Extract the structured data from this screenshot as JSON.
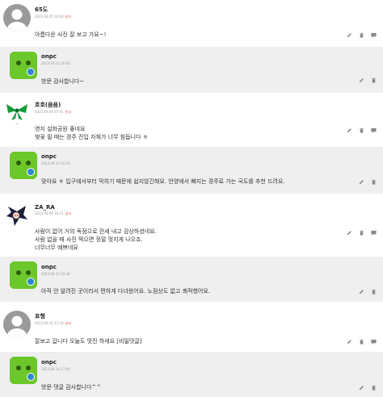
{
  "comments": [
    {
      "author": "65도",
      "date": "2023.04.05 16:10",
      "reply_label": "신고",
      "lines": [
        "아름다운 사진 잘 보고 가요~!"
      ],
      "avatar": "default",
      "reply": {
        "author": "onpc",
        "date": "2023.04.13 16:40",
        "lines": [
          "방문 감사합니다~"
        ]
      }
    },
    {
      "author": "호호(음음)",
      "date": "2023.04.04 07:41",
      "reply_label": "신고",
      "lines": [
        "영지 설화공원 좋네요",
        "벚꽃 필 때는 경주 진입 자체가 너무 힘듭니다 ㅎ"
      ],
      "avatar": "ribbon",
      "reply": {
        "author": "onpc",
        "date": "2023.04.13 16:43",
        "lines": [
          "맞아요 ㅎ 입구에서부터 막히기 때문에 쉽지않긴해요. 언양에서 빠지는 경주로 가는 국도를 추천 드려요."
        ]
      }
    },
    {
      "author": "ZA_RA",
      "date": "2023.04.06 16:21",
      "reply_label": "신고",
      "lines": [
        "사람이 없어 거의 독점으로 전세 내고 감상하셨네요.",
        "사람 없을 때 사진 찍으면 정말 멋지게 나오죠.",
        "너무너무 예쁘네요"
      ],
      "avatar": "char",
      "reply": {
        "author": "onpc",
        "date": "2023.04.13 16:44",
        "lines": [
          "아직 안 알려진 곳이라서 편하게 다녀왔어요. 노점상도 없고 쾌적했어요."
        ]
      }
    },
    {
      "author": "표형",
      "date": "2023.06.12 11:33",
      "reply_label": "신고",
      "lines": [
        "잘보고 갑니다 오늘도 멋진 하세요 [비밀댓글]"
      ],
      "avatar": "default",
      "reply": {
        "author": "onpc",
        "date": "2023.06.14 17:04",
        "lines": [
          "방문 댓글 감사합니다^^"
        ]
      }
    }
  ],
  "icons": {
    "edit": "pencil-icon",
    "delete": "trash-icon",
    "reply": "comment-icon"
  },
  "colors": {
    "reply_bg": "#efefef",
    "report": "#c33333",
    "avatar_green": "#6cc72a"
  }
}
